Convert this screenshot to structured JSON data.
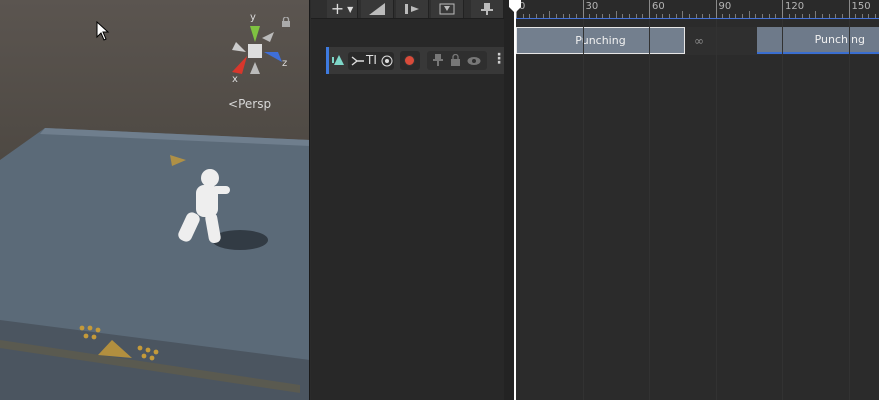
{
  "scene_view": {
    "projection_label": "Persp",
    "gizmo_axes": [
      "y",
      "x",
      "z"
    ]
  },
  "timeline": {
    "toolbar": {
      "add_icon": "plus-icon",
      "add_menu_icon": "dropdown-arrow-icon",
      "buttons": [
        "snap-icon",
        "step-forward-icon",
        "frame-icon",
        "pin-icon"
      ]
    },
    "ruler": {
      "ticks": [
        "0",
        "30",
        "60",
        "90",
        "120",
        "150"
      ]
    },
    "track": {
      "name": "TI",
      "accent_color": "#3e7be0"
    },
    "clips": [
      {
        "label": "Punching"
      },
      {
        "label": "Punching"
      }
    ]
  }
}
